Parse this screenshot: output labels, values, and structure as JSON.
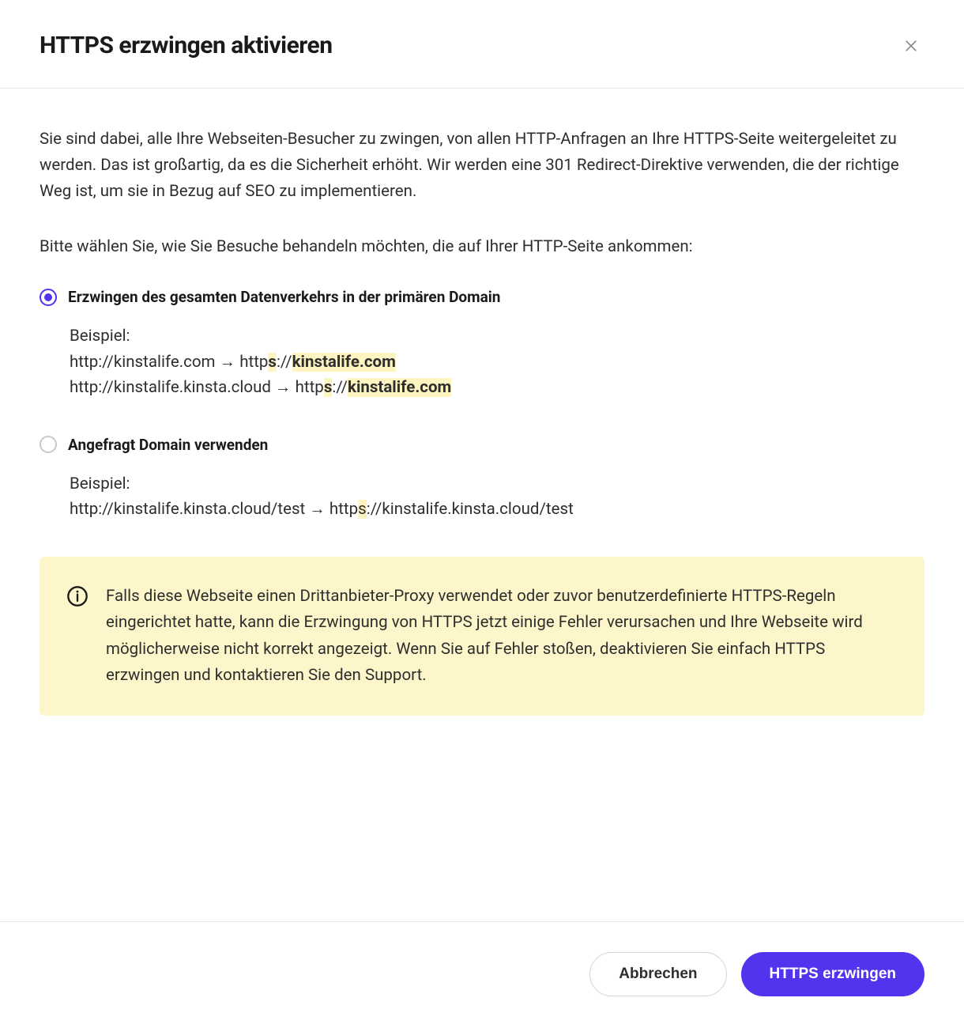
{
  "header": {
    "title": "HTTPS erzwingen aktivieren"
  },
  "body": {
    "intro": "Sie sind dabei, alle Ihre Webseiten-Besucher zu zwingen, von allen HTTP-Anfragen an Ihre HTTPS-Seite weitergeleitet zu werden. Das ist großartig, da es die Sicherheit erhöht. Wir werden eine 301 Redirect-Direktive verwenden, die der richtige Weg ist, um sie in Bezug auf SEO zu implementieren.",
    "select_line": "Bitte wählen Sie, wie Sie Besuche behandeln möchten, die auf Ihrer HTTP-Seite ankommen:",
    "option1": {
      "label": "Erzwingen des gesamten Datenverkehrs in der primären Domain",
      "example_label": "Beispiel:",
      "line1_from": "http://kinstalife.com → http",
      "line1_s": "s",
      "line1_mid": "://",
      "line1_to": "kinstalife.com",
      "line2_from": "http://kinstalife.kinsta.cloud  → http",
      "line2_s": "s",
      "line2_mid": "://",
      "line2_to": "kinstalife.com"
    },
    "option2": {
      "label": "Angefragt Domain verwenden",
      "example_label": "Beispiel:",
      "line_from": "http://kinstalife.kinsta.cloud/test → http",
      "line_s": "s",
      "line_tail": "://kinstalife.kinsta.cloud/test"
    },
    "info": "Falls diese Webseite einen Drittanbieter-Proxy verwendet oder zuvor benutzerdefinierte HTTPS-Regeln eingerichtet hatte, kann die Erzwingung von HTTPS jetzt einige Fehler verursachen und Ihre Webseite wird möglicherweise nicht korrekt angezeigt. Wenn Sie auf Fehler stoßen, deaktivieren Sie einfach HTTPS erzwingen und kontaktieren Sie den Support."
  },
  "footer": {
    "cancel": "Abbrechen",
    "confirm": "HTTPS erzwingen"
  }
}
